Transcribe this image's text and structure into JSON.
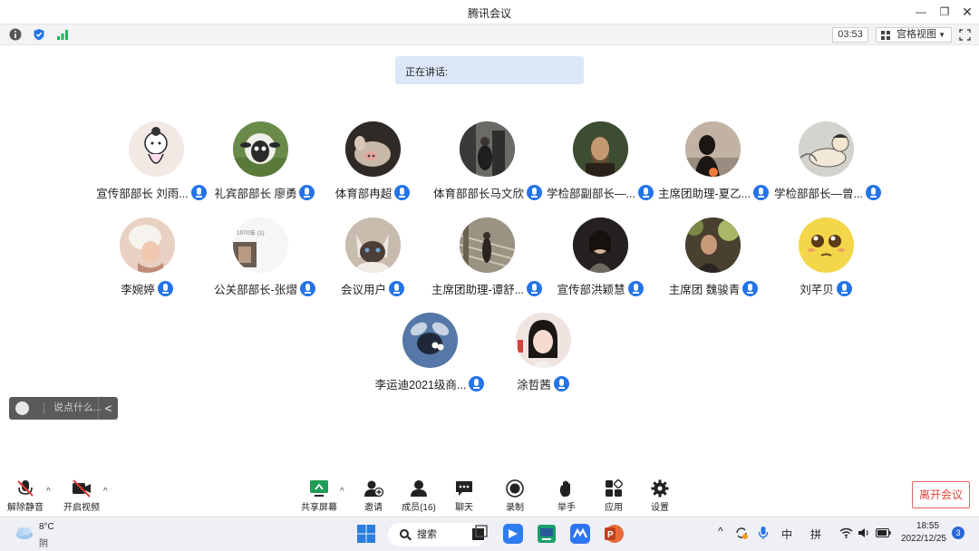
{
  "window": {
    "title": "腾讯会议"
  },
  "status": {
    "timer": "03:53",
    "view_mode": "宫格视图"
  },
  "speaking": {
    "label": "正在讲话:"
  },
  "participants": [
    {
      "name": "宣传部部长 刘雨...",
      "avatar_color": "#f3e9e4",
      "avatar_icon": "cartoon-girl"
    },
    {
      "name": "礼宾部部长 廖勇",
      "avatar_color": "#6a8a4a",
      "avatar_icon": "cartoon-sheep"
    },
    {
      "name": "体育部冉超",
      "avatar_color": "#3b3530",
      "avatar_icon": "pig-photo"
    },
    {
      "name": "体育部部长马文欣",
      "avatar_color": "#4a4a4a",
      "avatar_icon": "street-photo"
    },
    {
      "name": "学检部副部长—...",
      "avatar_color": "#3d5a3a",
      "avatar_icon": "painting"
    },
    {
      "name": "主席团助理-夏乙...",
      "avatar_color": "#b8a89a",
      "avatar_icon": "silhouette"
    },
    {
      "name": "学检部部长—曾...",
      "avatar_color": "#dcdcd8",
      "avatar_icon": "cartoon-sleep"
    },
    {
      "name": "李婉婷",
      "avatar_color": "#e6cbbd",
      "avatar_icon": "portrait"
    },
    {
      "name": "公关部部长-张熠",
      "avatar_color": "#f5f5f5",
      "avatar_icon": "photo-card"
    },
    {
      "name": "会议用户",
      "avatar_color": "#c9b8a3",
      "avatar_icon": "cat-photo"
    },
    {
      "name": "主席团助理-谭舒...",
      "avatar_color": "#8a8272",
      "avatar_icon": "stairs-photo"
    },
    {
      "name": "宣传部洪颖慧",
      "avatar_color": "#2e2b28",
      "avatar_icon": "portrait-dark"
    },
    {
      "name": "主席团 魏骏青",
      "avatar_color": "#5a4a38",
      "avatar_icon": "outdoor-photo"
    },
    {
      "name": "刘芊贝",
      "avatar_color": "#f2d24a",
      "avatar_icon": "emoji-face"
    },
    {
      "name": "李运迪2021级商...",
      "avatar_color": "#4d6e9e",
      "avatar_icon": "cartoon-fly"
    },
    {
      "name": "涂哲茜",
      "avatar_color": "#e8c8c0",
      "avatar_icon": "portrait-girl"
    }
  ],
  "photo_card_text": "1970年 (1)",
  "chat": {
    "placeholder": "说点什么...",
    "toggle": "<"
  },
  "toolbar": {
    "mute": "解除静音",
    "video": "开启视频",
    "share": "共享屏幕",
    "invite": "邀请",
    "members": "成员(16)",
    "chat": "聊天",
    "record": "录制",
    "raise_hand": "举手",
    "apps": "应用",
    "settings": "设置",
    "leave": "离开会议",
    "expand": "^"
  },
  "taskbar": {
    "temperature": "8°C",
    "condition": "阴",
    "search": "搜索",
    "time": "18:55",
    "date": "2022/12/25",
    "notifications": "3",
    "ime_lang": "中",
    "ime_mode": "拼",
    "tray_expand": "^"
  },
  "colors": {
    "accent": "#2473e8",
    "leave": "#e0443a",
    "speaking_bg": "#dce8fa"
  }
}
